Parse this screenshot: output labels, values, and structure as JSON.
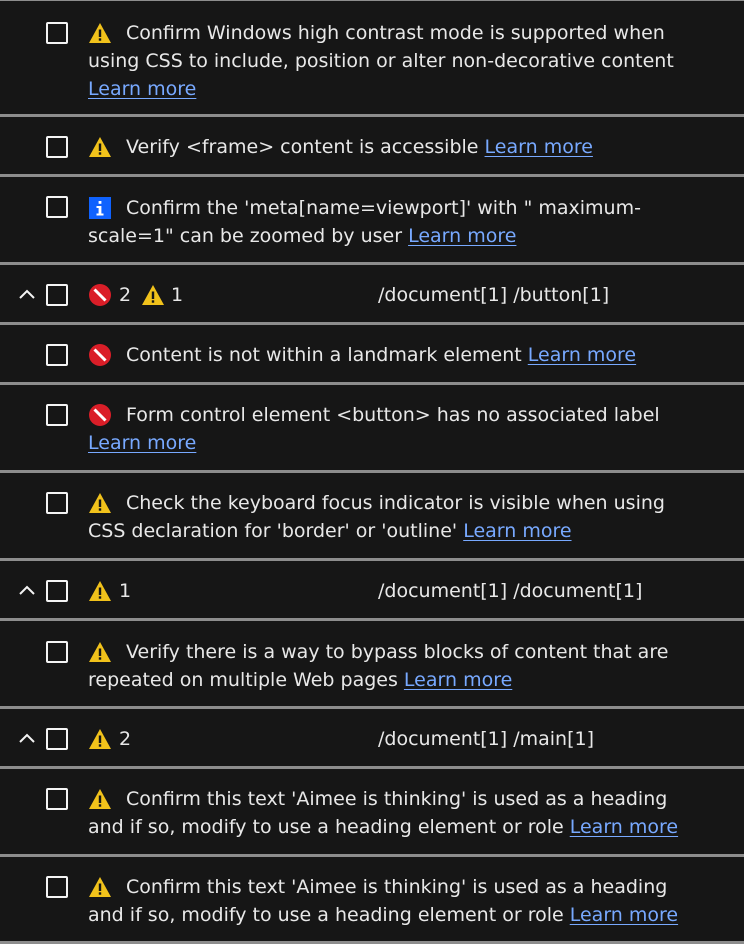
{
  "colors": {
    "background": "#161616",
    "divider": "#8d8d8d",
    "text": "#e8e8e8",
    "link": "#78a9ff",
    "violation": "#da1e28",
    "warning": "#f1c21b",
    "info": "#0f62fe"
  },
  "issues_top": [
    {
      "icon": "warning-icon",
      "line1": "Confirm Windows high contrast mode is supported when",
      "line2": "using CSS to include, position or alter non-decorative content",
      "link": "Learn more"
    },
    {
      "icon": "warning-icon",
      "line1": "Verify <frame> content is accessible",
      "link": "Learn more"
    },
    {
      "icon": "info-icon",
      "line1": "Confirm the 'meta[name=viewport]' with \" maximum-",
      "line2": "scale=1\" can be zoomed by user",
      "link": "Learn more"
    }
  ],
  "groups": [
    {
      "violations": "2",
      "warnings": "1",
      "xpath": "/document[1] /button[1]",
      "items": [
        {
          "icon": "violation-icon",
          "line1": "Content is not within a landmark element",
          "link": "Learn more"
        },
        {
          "icon": "violation-icon",
          "line1": "Form control element <button> has no associated label",
          "link": "Learn more"
        },
        {
          "icon": "warning-icon",
          "line1": "Check the keyboard focus indicator is visible when using",
          "line2": "CSS declaration for 'border' or 'outline'",
          "link": "Learn more"
        }
      ]
    },
    {
      "warnings": "1",
      "xpath": "/document[1] /document[1]",
      "items": [
        {
          "icon": "warning-icon",
          "line1": "Verify there is a way to bypass blocks of content that are",
          "line2": "repeated on multiple Web pages",
          "link": "Learn more"
        }
      ]
    },
    {
      "warnings": "2",
      "xpath": "/document[1] /main[1]",
      "items": [
        {
          "icon": "warning-icon",
          "line1": "Confirm this text 'Aimee is thinking' is used as a heading",
          "line2": "and if so, modify to use a heading element or role",
          "link": "Learn more"
        },
        {
          "icon": "warning-icon",
          "line1": "Confirm this text 'Aimee is thinking' is used as a heading",
          "line2": "and if so, modify to use a heading element or role",
          "link": "Learn more"
        }
      ]
    }
  ]
}
